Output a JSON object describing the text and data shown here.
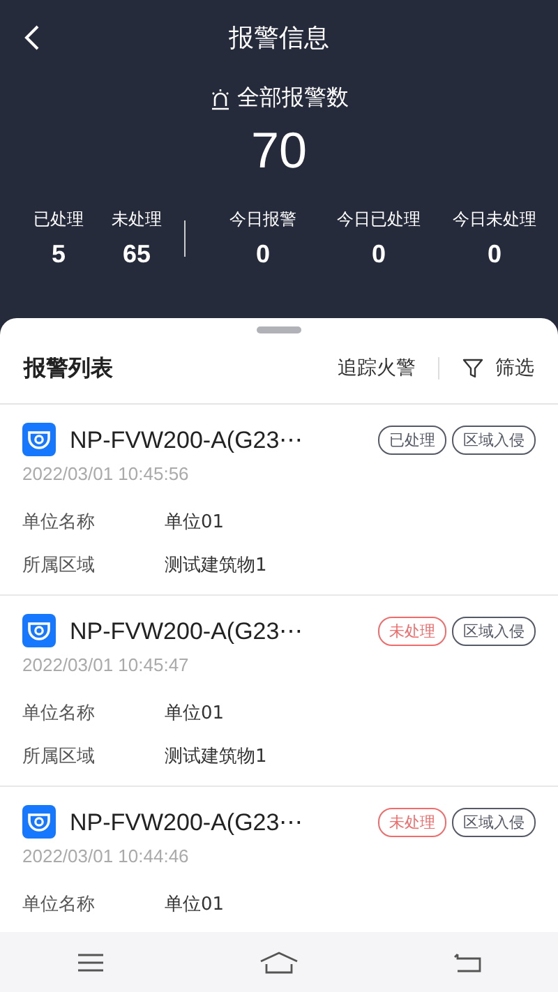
{
  "header": {
    "title": "报警信息",
    "total_label": "全部报警数",
    "total": "70"
  },
  "stats": [
    {
      "label": "已处理",
      "value": "5"
    },
    {
      "label": "未处理",
      "value": "65"
    },
    {
      "label": "今日报警",
      "value": "0"
    },
    {
      "label": "今日已处理",
      "value": "0"
    },
    {
      "label": "今日未处理",
      "value": "0"
    }
  ],
  "list": {
    "title": "报警列表",
    "track_fire": "追踪火警",
    "filter": "筛选"
  },
  "alarms": [
    {
      "device": "NP-FVW200-A(G23⋯",
      "handled": true,
      "status_label": "已处理",
      "type": "区域入侵",
      "time": "2022/03/01 10:45:56",
      "fields": [
        {
          "label": "单位名称",
          "value": "单位01"
        },
        {
          "label": "所属区域",
          "value": "测试建筑物1"
        }
      ]
    },
    {
      "device": "NP-FVW200-A(G23⋯",
      "handled": false,
      "status_label": "未处理",
      "type": "区域入侵",
      "time": "2022/03/01 10:45:47",
      "fields": [
        {
          "label": "单位名称",
          "value": "单位01"
        },
        {
          "label": "所属区域",
          "value": "测试建筑物1"
        }
      ]
    },
    {
      "device": "NP-FVW200-A(G23⋯",
      "handled": false,
      "status_label": "未处理",
      "type": "区域入侵",
      "time": "2022/03/01 10:44:46",
      "fields": [
        {
          "label": "单位名称",
          "value": "单位01"
        }
      ]
    }
  ]
}
